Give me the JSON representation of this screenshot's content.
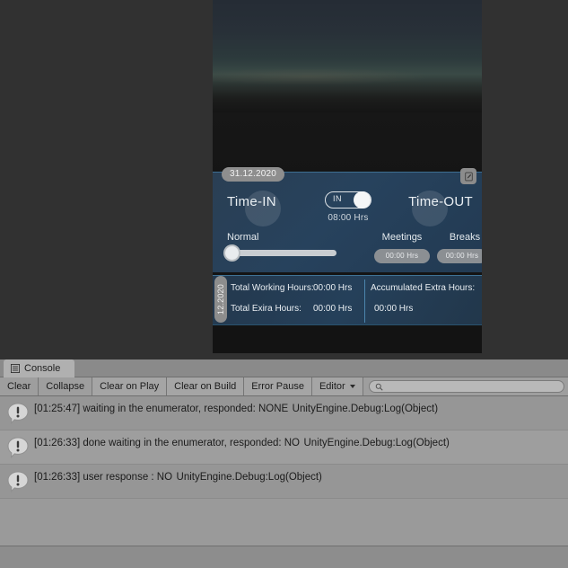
{
  "game_view": {
    "app_card": {
      "date_pill": "31.12.2020",
      "edit_icon": "edit-pencil-icon",
      "time_in_label": "Time-IN",
      "time_out_label": "Time-OUT",
      "toggle": {
        "state_label": "IN",
        "hours_label": "08:00 Hrs"
      },
      "slider": {
        "label": "Normal",
        "value_percent": 0
      },
      "meetings": {
        "title": "Meetings",
        "value": "00:00 Hrs"
      },
      "breaks": {
        "title": "Breaks",
        "value": "00:00 Hrs"
      }
    },
    "summary_card": {
      "vertical_date": "12.2020",
      "total_working_hours_label": "Total Working Hours:",
      "total_working_hours_value": "00:00 Hrs",
      "total_extra_hours_label": "Total Exira Hours:",
      "total_extra_hours_value": "00:00 Hrs",
      "accumulated_extra_hours_label": "Accumulated Extra Hours:",
      "accumulated_extra_hours_value": "00:00 Hrs"
    }
  },
  "console": {
    "tab": {
      "label": "Console",
      "icon": "console-list-icon"
    },
    "toolbar": {
      "clear": "Clear",
      "collapse": "Collapse",
      "clear_on_play": "Clear on Play",
      "clear_on_build": "Clear on Build",
      "error_pause": "Error Pause",
      "editor": "Editor",
      "search_placeholder": "",
      "search_value": "",
      "search_icon": "search-icon"
    },
    "entries": [
      {
        "icon": "log-info-icon",
        "message": "[01:25:47] waiting in the enumerator, responded: NONE",
        "source": "UnityEngine.Debug:Log(Object)"
      },
      {
        "icon": "log-info-icon",
        "message": "[01:26:33] done waiting in the enumerator, responded: NO",
        "source": "UnityEngine.Debug:Log(Object)"
      },
      {
        "icon": "log-info-icon",
        "message": "[01:26:33] user response : NO",
        "source": "UnityEngine.Debug:Log(Object)"
      }
    ]
  },
  "colors": {
    "editor_bg": "#313131",
    "console_bg": "#9a9a9a",
    "card_blue": "#27425d",
    "accent_line": "#3f7295",
    "pill_grey": "#8d8d8d"
  }
}
